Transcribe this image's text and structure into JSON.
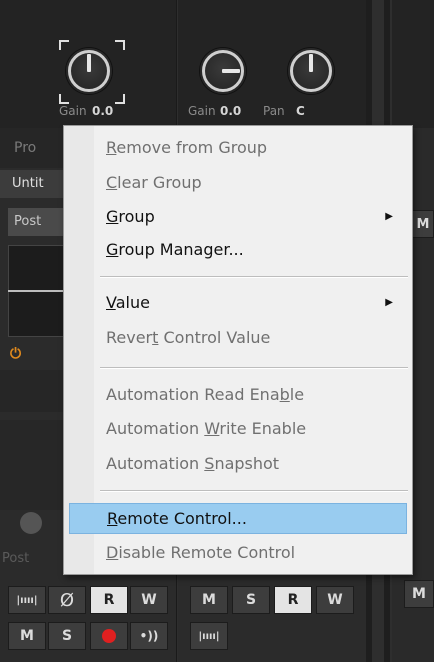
{
  "mixer": {
    "strip1": {
      "gain_label": "Gain",
      "gain_value": "0.0",
      "behind_labels": [
        "Pro",
        "Untit",
        "Post",
        "Post"
      ],
      "buttons_row1": [
        "R",
        "W"
      ],
      "buttons_row2": [
        "M",
        "S"
      ],
      "phase_symbol": "Ø",
      "wave_icon": "wave-icon"
    },
    "strip2": {
      "gain_label": "Gain",
      "gain_value": "0.0",
      "pan_label": "Pan",
      "pan_value": "C",
      "buttons_row1": [
        "M",
        "S",
        "R",
        "W"
      ]
    },
    "strip3": {
      "partial_label": "M"
    },
    "colors": {
      "record": "#e02020",
      "power": "#e08a1e",
      "highlight": "#99ccf0"
    }
  },
  "menu": {
    "items": [
      {
        "pre": "",
        "key": "R",
        "post": "emove from Group",
        "enabled": false,
        "submenu": false
      },
      {
        "pre": "",
        "key": "C",
        "post": "lear Group",
        "enabled": false,
        "submenu": false
      },
      {
        "pre": "",
        "key": "G",
        "post": "roup",
        "enabled": true,
        "submenu": true
      },
      {
        "pre": "",
        "key": "G",
        "post": "roup Manager...",
        "enabled": true,
        "submenu": false
      },
      {
        "pre": "",
        "key": "V",
        "post": "alue",
        "enabled": true,
        "submenu": true
      },
      {
        "pre": "Rever",
        "key": "t",
        "post": " Control Value",
        "enabled": false,
        "submenu": false
      },
      {
        "pre": "Automation Read Ena",
        "key": "b",
        "post": "le",
        "enabled": false,
        "submenu": false
      },
      {
        "pre": "Automation ",
        "key": "W",
        "post": "rite Enable",
        "enabled": false,
        "submenu": false
      },
      {
        "pre": "Automation ",
        "key": "S",
        "post": "napshot",
        "enabled": false,
        "submenu": false
      },
      {
        "pre": "",
        "key": "R",
        "post": "emote Control...",
        "enabled": true,
        "submenu": false,
        "highlighted": true
      },
      {
        "pre": "",
        "key": "D",
        "post": "isable Remote Control",
        "enabled": false,
        "submenu": false
      }
    ]
  }
}
